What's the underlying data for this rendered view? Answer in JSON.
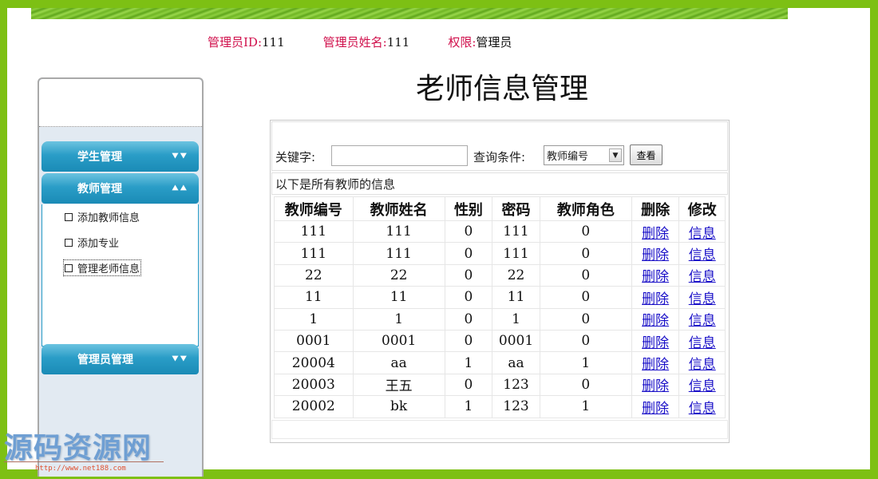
{
  "header": {
    "admin_id_label": "管理员ID:",
    "admin_id_value": "111",
    "admin_name_label": "管理员姓名:",
    "admin_name_value": "111",
    "role_label": "权限:",
    "role_value": "管理员"
  },
  "page_title": "老师信息管理",
  "sidebar": {
    "sections": [
      {
        "label": "学生管理",
        "icon": "chevron-double-down",
        "expanded": false
      },
      {
        "label": "教师管理",
        "icon": "chevron-double-up",
        "expanded": true
      },
      {
        "label": "管理员管理",
        "icon": "chevron-double-down",
        "expanded": false
      }
    ],
    "chev_down": "≫",
    "chev_up": "≪",
    "teacher_items": [
      {
        "label": "添加教师信息"
      },
      {
        "label": "添加专业"
      },
      {
        "label": "管理老师信息",
        "focused": true
      }
    ]
  },
  "search": {
    "keyword_label": "关键字:",
    "keyword_value": "",
    "condition_label": "查询条件:",
    "condition_selected": "教师编号",
    "submit_label": "查看"
  },
  "info_text": "以下是所有教师的信息",
  "table": {
    "columns": [
      "教师编号",
      "教师姓名",
      "性别",
      "密码",
      "教师角色",
      "删除",
      "修改"
    ],
    "delete_link": "删除",
    "edit_link": "信息",
    "rows": [
      {
        "id": "111",
        "name": "111",
        "gender": "0",
        "password": "111",
        "role": "0"
      },
      {
        "id": "111",
        "name": "111",
        "gender": "0",
        "password": "111",
        "role": "0"
      },
      {
        "id": "22",
        "name": "22",
        "gender": "0",
        "password": "22",
        "role": "0"
      },
      {
        "id": "11",
        "name": "11",
        "gender": "0",
        "password": "11",
        "role": "0"
      },
      {
        "id": "1",
        "name": "1",
        "gender": "0",
        "password": "1",
        "role": "0"
      },
      {
        "id": "0001",
        "name": "0001",
        "gender": "0",
        "password": "0001",
        "role": "0"
      },
      {
        "id": "20004",
        "name": "aa",
        "gender": "1",
        "password": "aa",
        "role": "1"
      },
      {
        "id": "20003",
        "name": "王五",
        "gender": "0",
        "password": "123",
        "role": "0"
      },
      {
        "id": "20002",
        "name": "bk",
        "gender": "1",
        "password": "123",
        "role": "1"
      }
    ]
  },
  "watermark": {
    "text": "源码资源网",
    "url": "http://www.net188.com"
  },
  "colors": {
    "frame_green": "#7dc014",
    "label_red": "#d0104c",
    "nav_blue": "#2a9dc7",
    "link_blue": "#1a10c8"
  }
}
